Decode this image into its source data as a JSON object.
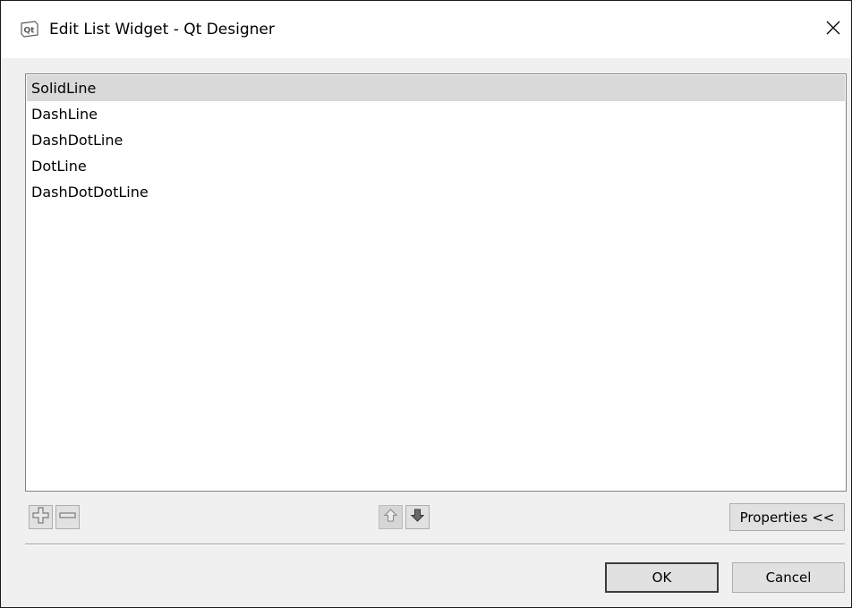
{
  "window": {
    "title": "Edit List Widget - Qt Designer"
  },
  "list": {
    "items": [
      {
        "label": "SolidLine",
        "selected": true
      },
      {
        "label": "DashLine",
        "selected": false
      },
      {
        "label": "DashDotLine",
        "selected": false
      },
      {
        "label": "DotLine",
        "selected": false
      },
      {
        "label": "DashDotDotLine",
        "selected": false
      }
    ]
  },
  "toolbar": {
    "add_icon": "plus-icon",
    "remove_icon": "minus-icon",
    "move_up_icon": "arrow-up-icon",
    "move_down_icon": "arrow-down-icon",
    "properties_label": "Properties <<"
  },
  "buttons": {
    "ok_label": "OK",
    "cancel_label": "Cancel"
  },
  "colors": {
    "selection": "#d9d9d9",
    "button_face": "#e1e1e1",
    "dialog_bg": "#f0f0f0"
  }
}
